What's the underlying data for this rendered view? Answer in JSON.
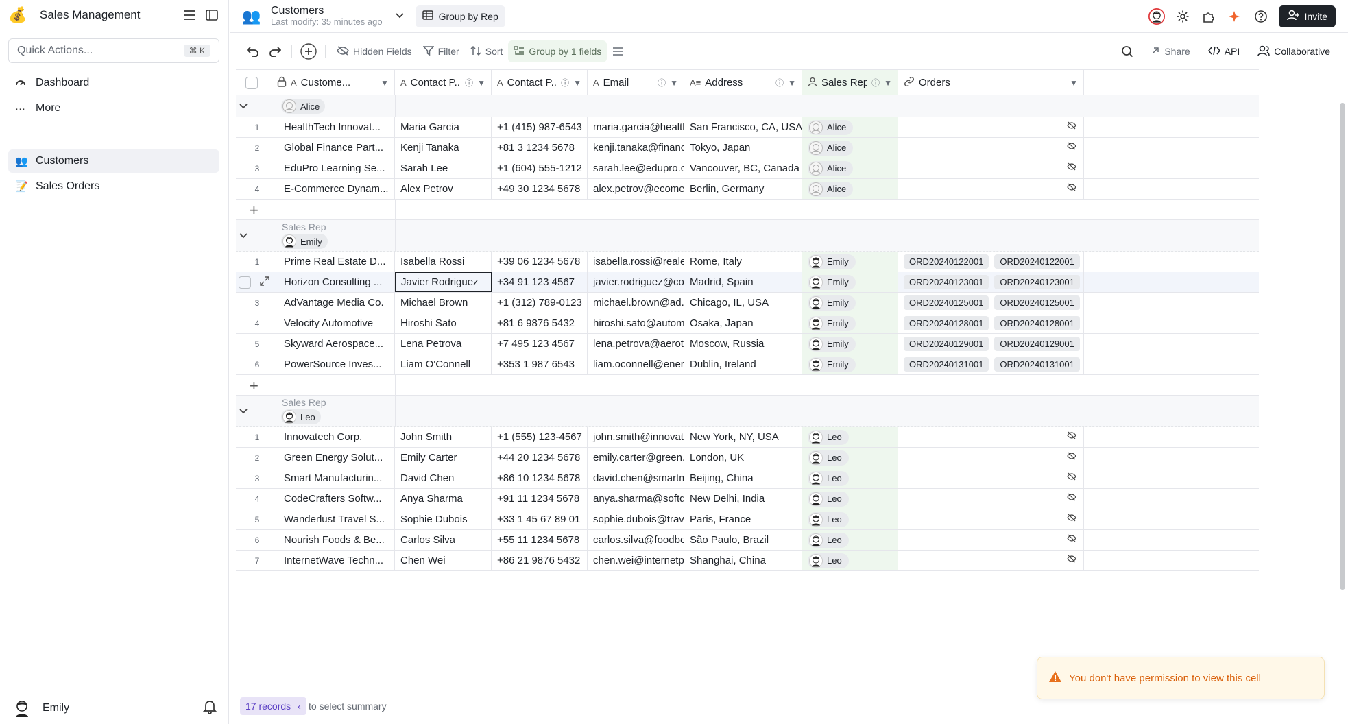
{
  "sidebar": {
    "app_title": "Sales Management",
    "quick_actions": {
      "placeholder": "Quick Actions...",
      "shortcut": "⌘ K"
    },
    "nav": [
      {
        "icon": "dashboard-icon",
        "label": "Dashboard"
      },
      {
        "icon": "more-icon",
        "label": "More"
      }
    ],
    "tables": [
      {
        "icon": "customers-icon",
        "label": "Customers"
      },
      {
        "icon": "sales-orders-icon",
        "label": "Sales Orders"
      }
    ],
    "user": {
      "name": "Emily"
    }
  },
  "topbar": {
    "table_title": "Customers",
    "last_modified": "Last modify: 35 minutes ago",
    "view_name": "Group by Rep",
    "invite_label": "Invite"
  },
  "toolbar": {
    "hidden_fields": "Hidden Fields",
    "filter": "Filter",
    "sort": "Sort",
    "group": "Group by 1 fields",
    "share": "Share",
    "api": "API",
    "collaborative": "Collaborative"
  },
  "columns": [
    {
      "name": "Custome...",
      "icon": "text-icon"
    },
    {
      "name": "Contact P...",
      "icon": "text-icon"
    },
    {
      "name": "Contact P...",
      "icon": "text-icon"
    },
    {
      "name": "Email",
      "icon": "text-icon"
    },
    {
      "name": "Address",
      "icon": "long-text-icon"
    },
    {
      "name": "Sales Rep",
      "icon": "user-icon"
    },
    {
      "name": "Orders",
      "icon": "link-icon"
    }
  ],
  "group_field_label": "Sales Rep",
  "groups": [
    {
      "rep": "Alice",
      "rows": [
        {
          "n": "1",
          "customer": "HealthTech Innovat...",
          "contact": "Maria Garcia",
          "phone": "+1 (415) 987-6543",
          "email": "maria.garcia@health...",
          "address": "San Francisco, CA, USA",
          "rep": "Alice"
        },
        {
          "n": "2",
          "customer": "Global Finance Part...",
          "contact": "Kenji Tanaka",
          "phone": "+81 3 1234 5678",
          "email": "kenji.tanaka@financ...",
          "address": "Tokyo, Japan",
          "rep": "Alice"
        },
        {
          "n": "3",
          "customer": "EduPro Learning Se...",
          "contact": "Sarah Lee",
          "phone": "+1 (604) 555-1212",
          "email": "sarah.lee@edupro.ca",
          "address": "Vancouver, BC, Canada",
          "rep": "Alice"
        },
        {
          "n": "4",
          "customer": "E-Commerce Dynam...",
          "contact": "Alex Petrov",
          "phone": "+49 30 1234 5678",
          "email": "alex.petrov@ecome...",
          "address": "Berlin, Germany",
          "rep": "Alice"
        }
      ]
    },
    {
      "rep": "Emily",
      "rows": [
        {
          "n": "1",
          "customer": "Prime Real Estate D...",
          "contact": "Isabella Rossi",
          "phone": "+39 06 1234 5678",
          "email": "isabella.rossi@reale...",
          "address": "Rome, Italy",
          "rep": "Emily",
          "orders": [
            "ORD20240122001",
            "ORD20240122001"
          ]
        },
        {
          "n": "2",
          "customer": "Horizon Consulting ...",
          "contact": "Javier Rodriguez",
          "phone": "+34 91 123 4567",
          "email": "javier.rodriguez@co...",
          "address": "Madrid, Spain",
          "rep": "Emily",
          "orders": [
            "ORD20240123001",
            "ORD20240123001"
          ]
        },
        {
          "n": "3",
          "customer": "AdVantage Media Co.",
          "contact": "Michael Brown",
          "phone": "+1 (312) 789-0123",
          "email": "michael.brown@ad...",
          "address": "Chicago, IL, USA",
          "rep": "Emily",
          "orders": [
            "ORD20240125001",
            "ORD20240125001"
          ]
        },
        {
          "n": "4",
          "customer": "Velocity Automotive",
          "contact": "Hiroshi Sato",
          "phone": "+81 6 9876 5432",
          "email": "hiroshi.sato@autom...",
          "address": "Osaka, Japan",
          "rep": "Emily",
          "orders": [
            "ORD20240128001",
            "ORD20240128001"
          ]
        },
        {
          "n": "5",
          "customer": "Skyward Aerospace...",
          "contact": "Lena Petrova",
          "phone": "+7 495 123 4567",
          "email": "lena.petrova@aerot...",
          "address": "Moscow, Russia",
          "rep": "Emily",
          "orders": [
            "ORD20240129001",
            "ORD20240129001"
          ]
        },
        {
          "n": "6",
          "customer": "PowerSource Inves...",
          "contact": "Liam O'Connell",
          "phone": "+353 1 987 6543",
          "email": "liam.oconnell@ener...",
          "address": "Dublin, Ireland",
          "rep": "Emily",
          "orders": [
            "ORD20240131001",
            "ORD20240131001"
          ]
        }
      ]
    },
    {
      "rep": "Leo",
      "rows": [
        {
          "n": "1",
          "customer": "Innovatech Corp.",
          "contact": "John Smith",
          "phone": "+1 (555) 123-4567",
          "email": "john.smith@innovat...",
          "address": "New York, NY, USA",
          "rep": "Leo"
        },
        {
          "n": "2",
          "customer": "Green Energy Solut...",
          "contact": "Emily Carter",
          "phone": "+44 20 1234 5678",
          "email": "emily.carter@green...",
          "address": "London, UK",
          "rep": "Leo"
        },
        {
          "n": "3",
          "customer": "Smart Manufacturin...",
          "contact": "David Chen",
          "phone": "+86 10 1234 5678",
          "email": "david.chen@smartm...",
          "address": "Beijing, China",
          "rep": "Leo"
        },
        {
          "n": "4",
          "customer": "CodeCrafters Softw...",
          "contact": "Anya Sharma",
          "phone": "+91 11 1234 5678",
          "email": "anya.sharma@softd...",
          "address": "New Delhi, India",
          "rep": "Leo"
        },
        {
          "n": "5",
          "customer": "Wanderlust Travel S...",
          "contact": "Sophie Dubois",
          "phone": "+33 1 45 67 89 01",
          "email": "sophie.dubois@trav...",
          "address": "Paris, France",
          "rep": "Leo"
        },
        {
          "n": "6",
          "customer": "Nourish Foods & Be...",
          "contact": "Carlos Silva",
          "phone": "+55 11 1234 5678",
          "email": "carlos.silva@foodbe...",
          "address": "São Paulo, Brazil",
          "rep": "Leo"
        },
        {
          "n": "7",
          "customer": "InternetWave Techn...",
          "contact": "Chen Wei",
          "phone": "+86 21 9876 5432",
          "email": "chen.wei@internetp...",
          "address": "Shanghai, China",
          "rep": "Leo"
        }
      ]
    }
  ],
  "status": {
    "records": "17 records",
    "hint": "to select summary"
  },
  "toast": {
    "message": "You don't have permission to view this cell"
  },
  "colors": {
    "accent_green": "#eef7ee",
    "record_badge": "#5b3fc4",
    "warning": "#d9600b"
  }
}
